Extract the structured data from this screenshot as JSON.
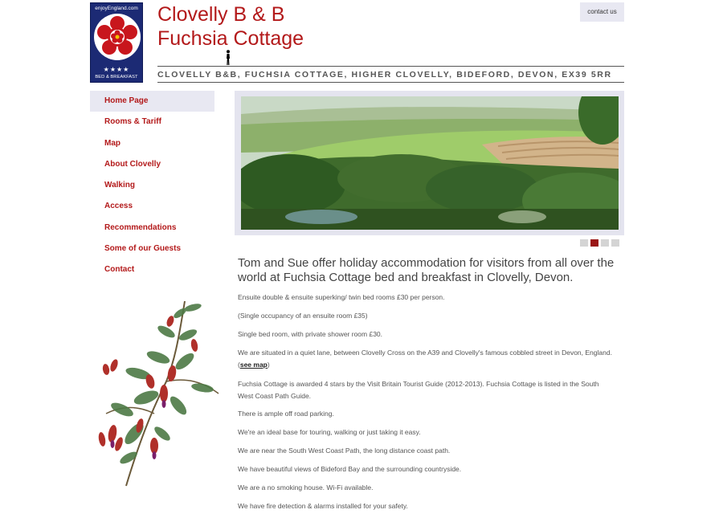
{
  "logo": {
    "top_text": "enjoyEngland.com",
    "stars": "★★★★",
    "bottom_text": "BED & BREAKFAST"
  },
  "header": {
    "title_line1": "Clovelly B & B",
    "title_line2": "Fuchsia Cottage",
    "contact_label": "contact us",
    "address": "CLOVELLY B&B, FUCHSIA COTTAGE, HIGHER CLOVELLY, BIDEFORD, DEVON, EX39 5RR"
  },
  "nav": {
    "items": [
      {
        "label": "Home Page"
      },
      {
        "label": "Rooms & Tariff"
      },
      {
        "label": "Map"
      },
      {
        "label": "About Clovelly"
      },
      {
        "label": "Walking"
      },
      {
        "label": "Access"
      },
      {
        "label": "Recommendations"
      },
      {
        "label": "Some of our Guests"
      },
      {
        "label": "Contact"
      }
    ]
  },
  "slider": {
    "slide_count": 4,
    "active_index": 1
  },
  "content": {
    "intro": "Tom and Sue offer holiday accommodation for visitors from all over the world at Fuchsia Cottage bed and breakfast in Clovelly, Devon.",
    "p1": "Ensuite double & ensuite superking/ twin bed rooms £30 per person.",
    "p2": "(Single occupancy of an ensuite room £35)",
    "p3": "Single bed room, with private shower room £30.",
    "p4_text": "We are situated in a quiet lane, between Clovelly Cross on the A39 and Clovelly's famous cobbled street in Devon, England. (",
    "p4_link": "see map",
    "p4_end": ")",
    "p5": "Fuchsia Cottage is awarded 4 stars by the Visit Britain Tourist Guide (2012-2013). Fuchsia Cottage is listed in the South West Coast Path Guide.",
    "p6": "There is ample off road parking.",
    "p7": "We're an ideal base for touring, walking or just taking it easy.",
    "p8": "We are near the South West Coast Path, the long distance coast path.",
    "p9": "We have beautiful views of Bideford Bay and the surrounding countryside.",
    "p10": "We are a no smoking house. Wi-Fi available.",
    "p11": "We have fire detection & alarms installed for your safety."
  },
  "colors": {
    "brand_red": "#b3191a",
    "nav_active_bg": "#e8e8f2",
    "logo_blue": "#1c2a74"
  }
}
